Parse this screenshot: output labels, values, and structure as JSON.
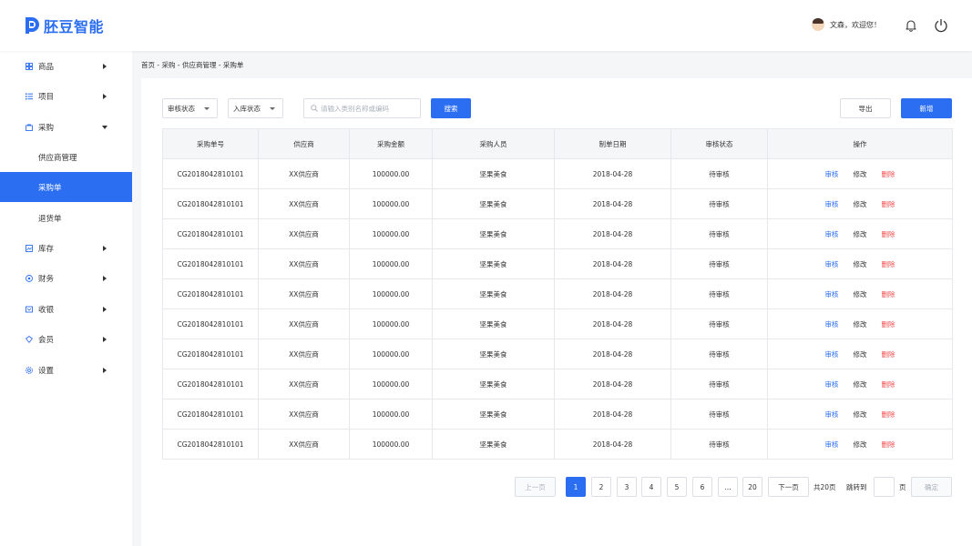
{
  "app": {
    "logo_text": "胚豆智能",
    "brand_color": "#2c6ef2"
  },
  "header": {
    "greeting": "文森，欢迎您！",
    "avatar_icon": "user-avatar",
    "bell_icon": "bell-icon",
    "power_icon": "power-icon"
  },
  "sidebar": {
    "items": [
      {
        "label": "商品",
        "icon": "grid-icon"
      },
      {
        "label": "项目",
        "icon": "list-icon"
      },
      {
        "label": "采购",
        "icon": "bag-icon"
      },
      {
        "label": "库存",
        "icon": "inventory-icon"
      },
      {
        "label": "财务",
        "icon": "finance-icon"
      },
      {
        "label": "收银",
        "icon": "cashier-icon"
      },
      {
        "label": "会员",
        "icon": "member-icon"
      },
      {
        "label": "设置",
        "icon": "settings-icon"
      }
    ],
    "sub_items": [
      {
        "label": "供应商管理"
      },
      {
        "label": "采购单",
        "active": true
      },
      {
        "label": "退货单"
      }
    ]
  },
  "breadcrumb": "首页 - 采购 - 供应商管理 - 采购单",
  "filters": {
    "audit_status": "审核状态",
    "stock_status": "入库状态",
    "search_placeholder": "请输入类别名称或编码",
    "search_button": "搜索",
    "export_button": "导出",
    "add_button": "新增"
  },
  "table": {
    "headers": [
      "采购单号",
      "供应商",
      "采购金额",
      "采购人员",
      "制单日期",
      "审核状态",
      "操作"
    ],
    "rows": [
      {
        "order_no": "CG2018042810101",
        "supplier": "XX供应商",
        "amount": "100000.00",
        "buyer": "坚果美食",
        "date": "2018-04-28",
        "status": "待审核"
      },
      {
        "order_no": "CG2018042810101",
        "supplier": "XX供应商",
        "amount": "100000.00",
        "buyer": "坚果美食",
        "date": "2018-04-28",
        "status": "待审核"
      },
      {
        "order_no": "CG2018042810101",
        "supplier": "XX供应商",
        "amount": "100000.00",
        "buyer": "坚果美食",
        "date": "2018-04-28",
        "status": "待审核"
      },
      {
        "order_no": "CG2018042810101",
        "supplier": "XX供应商",
        "amount": "100000.00",
        "buyer": "坚果美食",
        "date": "2018-04-28",
        "status": "待审核"
      },
      {
        "order_no": "CG2018042810101",
        "supplier": "XX供应商",
        "amount": "100000.00",
        "buyer": "坚果美食",
        "date": "2018-04-28",
        "status": "待审核"
      },
      {
        "order_no": "CG2018042810101",
        "supplier": "XX供应商",
        "amount": "100000.00",
        "buyer": "坚果美食",
        "date": "2018-04-28",
        "status": "待审核"
      },
      {
        "order_no": "CG2018042810101",
        "supplier": "XX供应商",
        "amount": "100000.00",
        "buyer": "坚果美食",
        "date": "2018-04-28",
        "status": "待审核"
      },
      {
        "order_no": "CG2018042810101",
        "supplier": "XX供应商",
        "amount": "100000.00",
        "buyer": "坚果美食",
        "date": "2018-04-28",
        "status": "待审核"
      },
      {
        "order_no": "CG2018042810101",
        "supplier": "XX供应商",
        "amount": "100000.00",
        "buyer": "坚果美食",
        "date": "2018-04-28",
        "status": "待审核"
      },
      {
        "order_no": "CG2018042810101",
        "supplier": "XX供应商",
        "amount": "100000.00",
        "buyer": "坚果美食",
        "date": "2018-04-28",
        "status": "待审核"
      }
    ],
    "actions": {
      "audit": "审核",
      "edit": "修改",
      "delete": "删除"
    }
  },
  "pagination": {
    "prev": "上一页",
    "pages": [
      "1",
      "2",
      "3",
      "4",
      "5",
      "6",
      "…",
      "20"
    ],
    "current": "1",
    "next": "下一页",
    "total": "共20页",
    "jump_label": "跳转到",
    "page_unit": "页",
    "confirm": "确定"
  }
}
